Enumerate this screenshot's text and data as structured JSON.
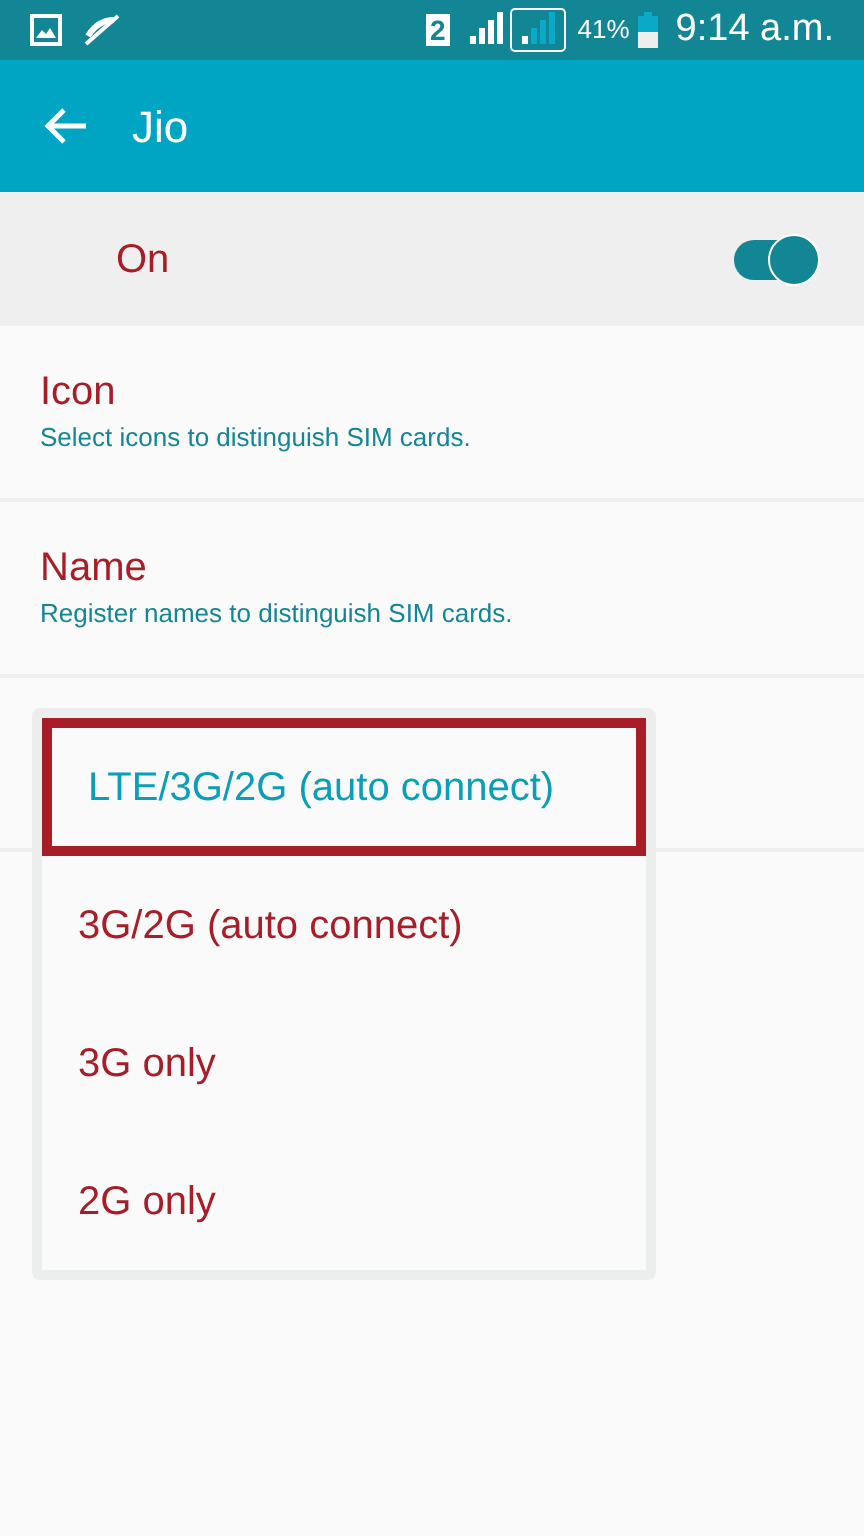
{
  "status_bar": {
    "sim": "2",
    "battery_text": "41%",
    "time": "9:14 a.m."
  },
  "app_bar": {
    "title": "Jio"
  },
  "master_switch": {
    "label": "On",
    "on": true
  },
  "settings": [
    {
      "title": "Icon",
      "subtitle": "Select icons to distinguish SIM cards."
    },
    {
      "title": "Name",
      "subtitle": "Register names to distinguish SIM cards."
    }
  ],
  "network_menu": [
    {
      "label": "LTE/3G/2G (auto connect)",
      "selected": true
    },
    {
      "label": "3G/2G (auto connect)",
      "selected": false
    },
    {
      "label": "3G only",
      "selected": false
    },
    {
      "label": "2G only",
      "selected": false
    }
  ]
}
